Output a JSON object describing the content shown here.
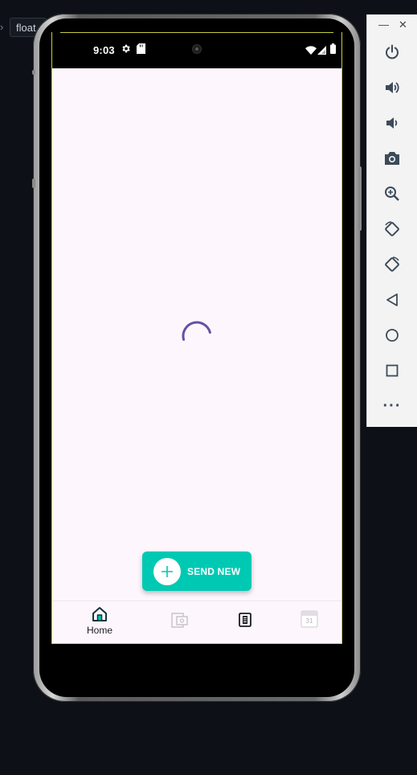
{
  "host": {
    "tab_label": "float"
  },
  "status_bar": {
    "time": "9:03"
  },
  "main": {
    "loading": true
  },
  "fab": {
    "label": "SEND NEW",
    "icon": "plus-icon"
  },
  "bottom_nav": {
    "items": [
      {
        "label": "Home",
        "icon": "home-icon",
        "active": true
      },
      {
        "label": "",
        "icon": "money-transfer-icon",
        "active": false
      },
      {
        "label": "",
        "icon": "document-icon",
        "active": false
      },
      {
        "label": "",
        "icon": "calendar-icon",
        "active": false,
        "badge_text": "31"
      }
    ]
  },
  "system_nav": [
    "back-icon",
    "home-circle-icon",
    "recents-icon"
  ],
  "emulator_toolbar": {
    "window_controls": [
      "minimize-icon",
      "close-icon"
    ],
    "tools": [
      "power-icon",
      "volume-up-icon",
      "volume-down-icon",
      "camera-icon",
      "zoom-icon",
      "rotate-left-icon",
      "rotate-right-icon",
      "back-icon",
      "home-icon",
      "overview-icon",
      "more-icon"
    ]
  },
  "colors": {
    "accent": "#00c9b3",
    "spinner": "#6750a4",
    "app_background": "#fdf7fd",
    "screen_border": "#c7cf3a"
  }
}
